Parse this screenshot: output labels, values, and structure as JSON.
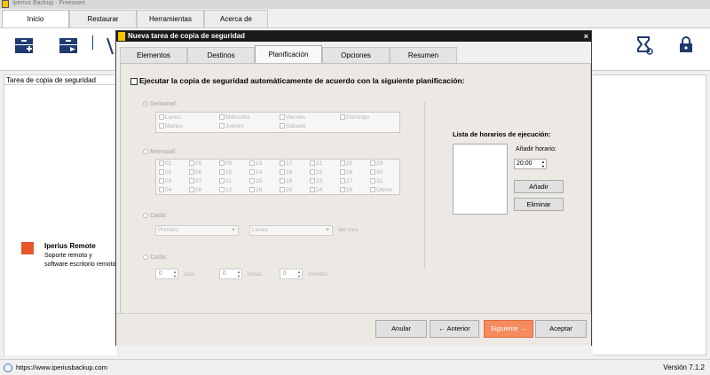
{
  "app": {
    "title": "Iperius Backup - Freeware",
    "tabs": [
      {
        "label": "Inicio",
        "active": true
      },
      {
        "label": "Restaurar",
        "active": false
      },
      {
        "label": "Herramientas",
        "active": false
      },
      {
        "label": "Acerca de",
        "active": false
      }
    ],
    "panel_header": "Tarea de copia de seguridad",
    "remote": {
      "title": "Iperius Remote",
      "description": "Soporte remoto y software escritorio remoto"
    },
    "status": {
      "url": "https://www.iperiusbackup.com",
      "version": "Versión 7.1.2"
    }
  },
  "dialog": {
    "title": "Nueva tarea de copia de seguridad",
    "close": "×",
    "tabs": [
      {
        "label": "Elementos",
        "active": false
      },
      {
        "label": "Destinos",
        "active": false
      },
      {
        "label": "Planificación",
        "active": true
      },
      {
        "label": "Opciones",
        "active": false
      },
      {
        "label": "Resumen",
        "active": false
      }
    ],
    "schedule_checkbox": "Ejecutar la copia de seguridad automáticamente de acuerdo con la siguiente planificación:",
    "weekly": {
      "label": "Semanal:",
      "days": [
        "Lunes",
        "Martes",
        "Miércoles",
        "Jueves",
        "Viernes",
        "Sábado",
        "Domingo"
      ]
    },
    "monthly": {
      "label": "Mensual:",
      "days": [
        "01",
        "02",
        "03",
        "04",
        "05",
        "06",
        "07",
        "08",
        "09",
        "10",
        "11",
        "12",
        "13",
        "14",
        "15",
        "16",
        "17",
        "18",
        "19",
        "20",
        "21",
        "22",
        "23",
        "24",
        "25",
        "26",
        "27",
        "28",
        "29",
        "30",
        "31",
        "Último"
      ]
    },
    "each": {
      "label": "Cada:",
      "ordinal": "Primero",
      "weekday": "Lunes",
      "suffix": "del mes"
    },
    "interval": {
      "label": "Cada:",
      "days_value": "0",
      "days_unit": "días",
      "hours_value": "0",
      "hours_unit": "horas",
      "minutes_value": "0",
      "minutes_unit": "minutos"
    },
    "times_label": "Lista de horarios de ejecución:",
    "add_time_label": "Añadir horario:",
    "time_value": "20:00",
    "add_button": "Añadir",
    "delete_button": "Eliminar",
    "footer": {
      "cancel": "Anular",
      "previous": "← Anterior",
      "next": "Siguiente →",
      "accept": "Aceptar"
    }
  }
}
